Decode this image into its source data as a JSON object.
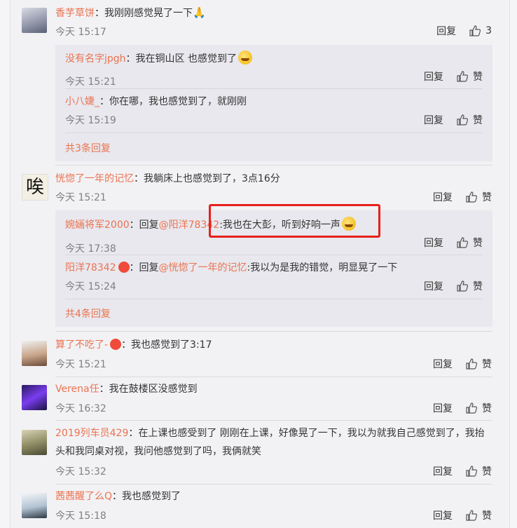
{
  "comments": [
    {
      "user": "香芋草饼",
      "text": "：我刚刚感觉晃了一下",
      "time": "今天 15:17",
      "reply": "回复",
      "likes": "3",
      "replies": [
        {
          "user": "没有名字jpgh",
          "text": "：我在铜山区 也感觉到了",
          "time": "今天 15:21",
          "reply": "回复",
          "like": "赞"
        },
        {
          "user": "小八婕_",
          "text": "：你在哪，我也感觉到了，就刚刚",
          "time": "今天 15:19",
          "reply": "回复",
          "like": "赞"
        }
      ],
      "more": "共3条回复"
    },
    {
      "user": "恍惚了一年的记忆",
      "text": "：我躺床上也感觉到了，3点16分",
      "time": "今天 15:21",
      "reply": "回复",
      "like": "赞",
      "avatar_char": "唉",
      "replies": [
        {
          "user": "婉婳将军2000",
          "prefix": "：回复",
          "at": "@阳洋78342",
          "text": ":我也在大彭，听到好响一声",
          "time": "今天 17:38",
          "reply": "回复",
          "like": "赞"
        },
        {
          "user": "阳洋78342",
          "prefix": "：回复",
          "at": "@恍惚了一年的记忆",
          "text": ":我以为是我的错觉，明显晃了一下",
          "time": "今天 15:24",
          "reply": "回复",
          "like": "赞"
        }
      ],
      "more": "共4条回复"
    },
    {
      "user": "算了不吃了-",
      "text": "：我也感觉到了3:17",
      "time": "今天 15:21",
      "reply": "回复",
      "like": "赞"
    },
    {
      "user": "Verena任",
      "text": "：我在鼓楼区没感觉到",
      "time": "今天 16:32",
      "reply": "回复",
      "like": "赞"
    },
    {
      "user": "2019列车员429",
      "text": "：在上课也感受到了 刚刚在上课，好像晃了一下，我以为就我自己感觉到了，我抬头和我同桌对视，我问他感觉到了吗，我俩就笑",
      "time": "今天 15:32",
      "reply": "回复",
      "like": "赞"
    },
    {
      "user": "茜茜醒了么Q",
      "text": "：我也感觉到了",
      "time": "今天 15:18",
      "reply": "回复",
      "like": "赞"
    }
  ],
  "colors": {
    "username": "#eb7350",
    "highlight": "#e8201b",
    "time": "#808080"
  }
}
